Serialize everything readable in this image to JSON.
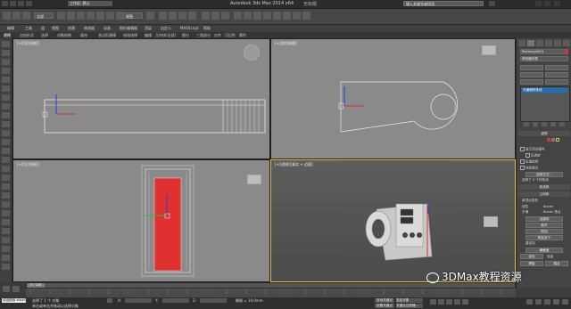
{
  "window": {
    "app_title": "Autodesk 3ds Max  2014 x64",
    "file_name": "无标题",
    "workspace": "工作区: 默认",
    "search_value": "键入关键字或短语"
  },
  "toolbar": {
    "selection_filter": "全部",
    "ref_coord": "视图"
  },
  "menu": {
    "items": [
      "编辑",
      "工具",
      "组",
      "视图",
      "创建",
      "修改器",
      "动画",
      "图形编辑器",
      "渲染",
      "自定义",
      "MAXScript",
      "帮助"
    ]
  },
  "ribbon": {
    "items": [
      "建模",
      "自由形式",
      "选择",
      "对象绘制",
      "填充",
      "多边形建模",
      "修改选择",
      "编辑",
      "几何体(全部)",
      "细分",
      "三角剖分",
      "对齐",
      "可见性",
      "属性"
    ]
  },
  "viewports": {
    "top_label": "[+][顶][线框]",
    "front_label": "[+][前][线框]",
    "left_label": "[+][左][线框]",
    "persp_label": "[+][透视][真实 + 边面]"
  },
  "command_panel": {
    "object_name": "Rectangle001",
    "modifier_list": "修改器列表",
    "stack_item": "可编辑样条线",
    "rollout_selection": "选择",
    "show_vertex_numbers": "显示顶点编号",
    "only_selected": "仅选定",
    "area_selection": "区域选择",
    "segment_end": "线段端点",
    "select_by": "选择方式...",
    "selected_count": "选择了 0 个样条线",
    "soft_selection": "软选择",
    "geometry": "几何体",
    "new_vertex_type": "新顶点类型",
    "linear": "线性",
    "smooth": "平滑",
    "bezier": "Bezier",
    "bezier_corner": "Bezier 角点",
    "create_line": "创建线",
    "break": "断开",
    "attach": "附加",
    "attach_multiple": "附加多个",
    "reorient": "重定向",
    "cross_section": "横截面",
    "refine": "优化",
    "connect": "连接",
    "weld": "焊接",
    "fuse": "熔合"
  },
  "timeline": {
    "frame_readout": "0 / 100"
  },
  "status": {
    "welcome": "欢迎使用 MAXSc",
    "selection_info": "选择了 1 个 对象",
    "prompt": "单击或单击并拖动以选择对象",
    "x_label": "X:",
    "y_label": "Y:",
    "z_label": "Z:",
    "grid_info": "栅格 = 10.0mm",
    "auto_key": "自动关键点",
    "set_key": "设置关键点",
    "selected": "选定对象",
    "key_filters": "关键点过滤器..."
  },
  "watermark": {
    "text": "3DMax教程资源"
  },
  "colors": {
    "accent_red": "#e03030",
    "selection_blue": "#1f6fbf",
    "active_border": "#e0c040"
  }
}
